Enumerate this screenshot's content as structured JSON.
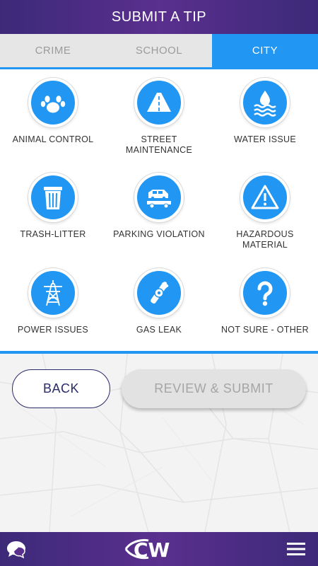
{
  "header": {
    "title": "SUBMIT A TIP"
  },
  "tabs": [
    {
      "label": "CRIME",
      "active": false
    },
    {
      "label": "SCHOOL",
      "active": false
    },
    {
      "label": "CITY",
      "active": true
    }
  ],
  "categories": [
    {
      "label": "ANIMAL CONTROL",
      "icon": "paw-icon"
    },
    {
      "label": "STREET MAINTENANCE",
      "icon": "road-icon"
    },
    {
      "label": "WATER ISSUE",
      "icon": "water-drop-icon"
    },
    {
      "label": "TRASH-LITTER",
      "icon": "trash-can-icon"
    },
    {
      "label": "PARKING VIOLATION",
      "icon": "tow-truck-icon"
    },
    {
      "label": "HAZARDOUS MATERIAL",
      "icon": "warning-triangle-icon"
    },
    {
      "label": "POWER ISSUES",
      "icon": "power-tower-icon"
    },
    {
      "label": "GAS LEAK",
      "icon": "gas-pipe-icon"
    },
    {
      "label": "NOT SURE - OTHER",
      "icon": "question-icon"
    }
  ],
  "buttons": {
    "back": "BACK",
    "review": "REVIEW & SUBMIT"
  },
  "footer": {
    "logo_text": "CW",
    "chat_icon": "chat-bubble-icon",
    "menu_icon": "hamburger-menu-icon"
  },
  "colors": {
    "brand_purple": "#4a2d82",
    "accent_blue": "#2196f3",
    "disabled_gray": "#e2e2e2"
  }
}
